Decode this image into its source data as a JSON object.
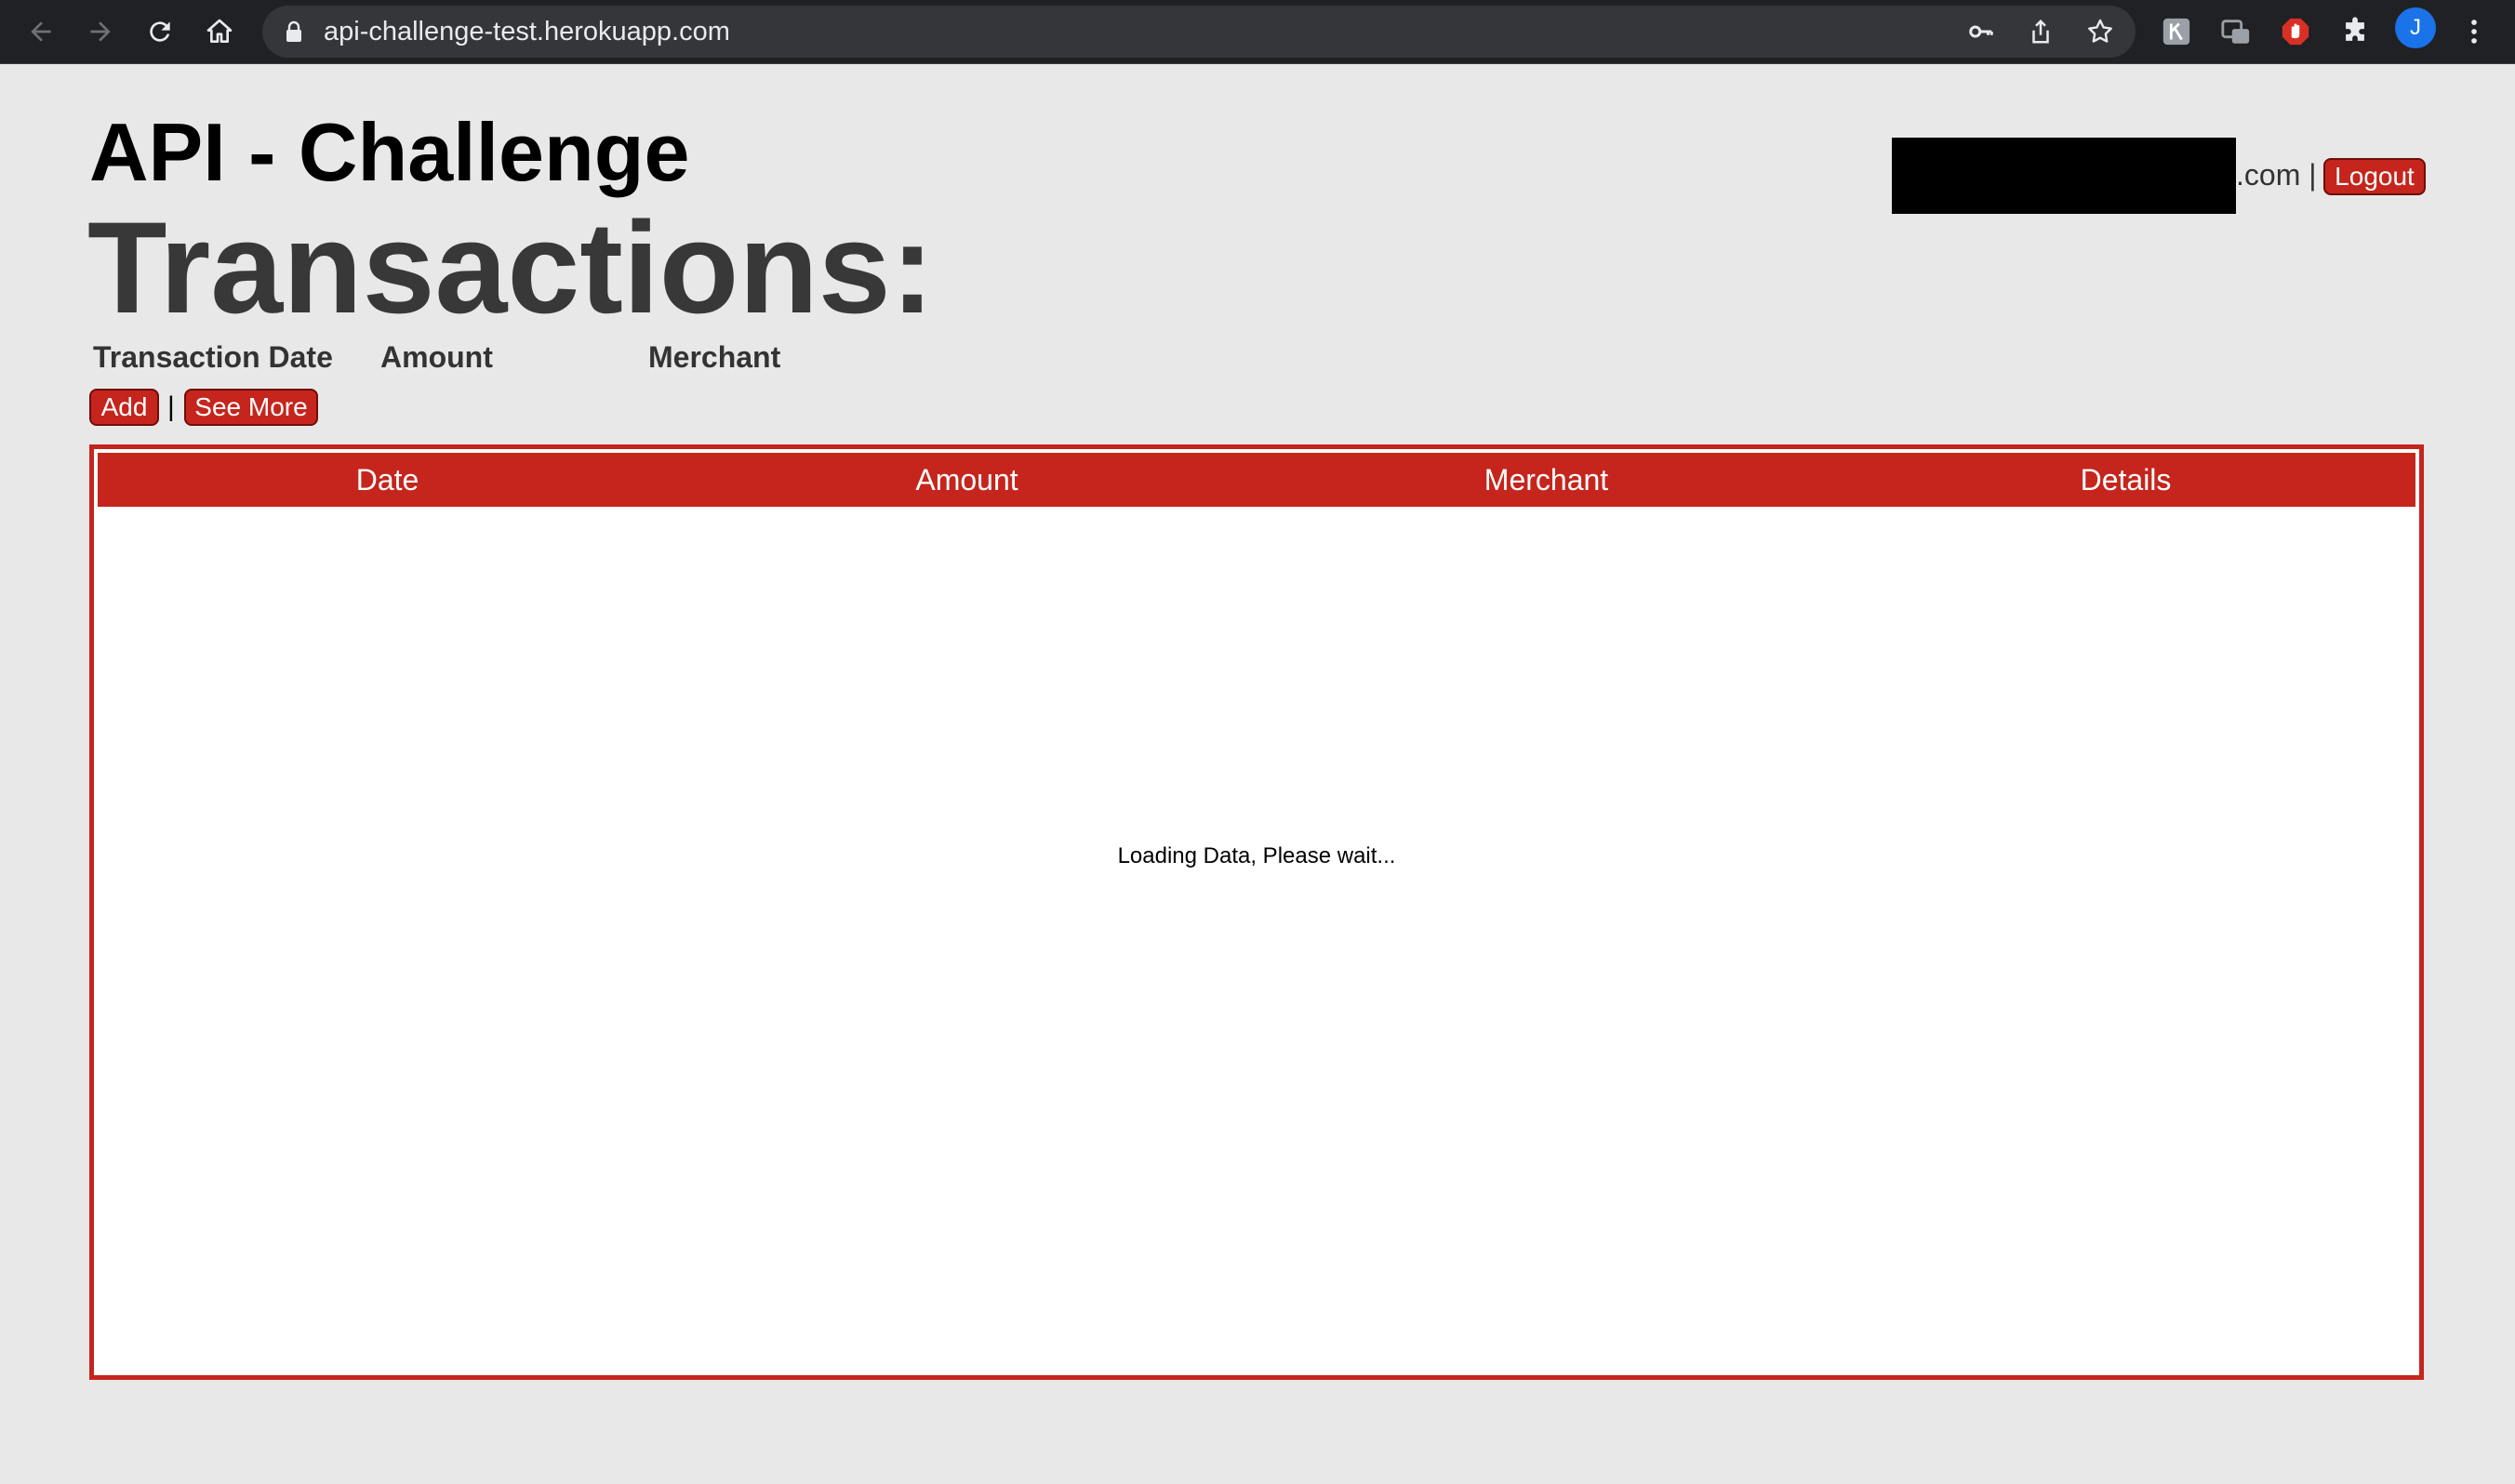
{
  "browser": {
    "url": "api-challenge-test.herokuapp.com",
    "profile_initial": "J"
  },
  "page": {
    "app_title": "API - Challenge",
    "heading": "Transactions:",
    "filters": {
      "date_label": "Transaction Date",
      "amount_label": "Amount",
      "merchant_label": "Merchant"
    },
    "actions": {
      "add_label": "Add",
      "separator": "|",
      "see_more_label": "See More"
    },
    "user": {
      "email_suffix": ".com |",
      "logout_label": "Logout"
    },
    "table": {
      "columns": [
        "Date",
        "Amount",
        "Merchant",
        "Details"
      ],
      "status": "Loading Data, Please wait..."
    }
  },
  "colors": {
    "accent": "#c5251c",
    "background": "#e8e8e8"
  }
}
